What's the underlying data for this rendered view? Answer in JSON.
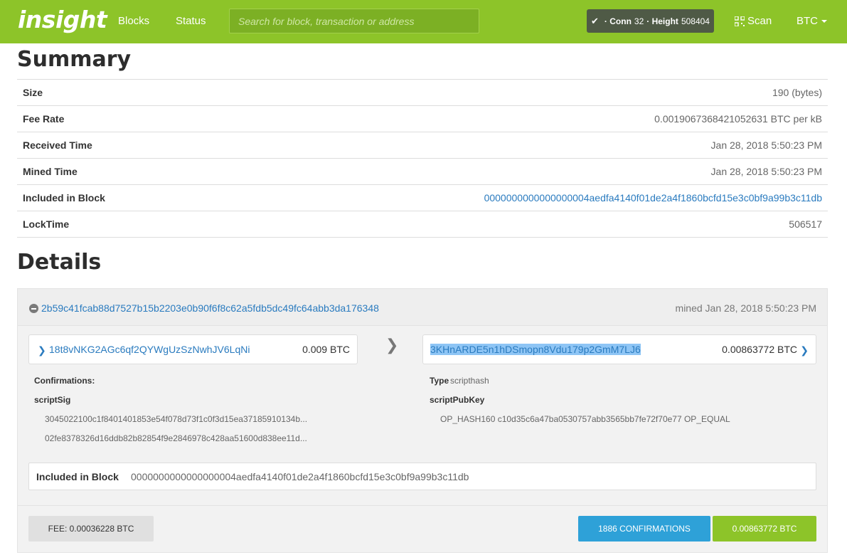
{
  "nav": {
    "brand": "insight",
    "links": [
      "Blocks",
      "Status"
    ],
    "search_placeholder": "Search for block, transaction or address",
    "conn_label": "· Conn",
    "conn_value": "32",
    "height_label": "· Height",
    "height_value": "508404",
    "scan_label": "Scan",
    "currency": "BTC"
  },
  "summary": {
    "heading": "Summary",
    "rows": [
      {
        "label": "Size",
        "value": "190 (bytes)"
      },
      {
        "label": "Fee Rate",
        "value": "0.0019067368421052631 BTC per kB"
      },
      {
        "label": "Received Time",
        "value": "Jan 28, 2018 5:50:23 PM"
      },
      {
        "label": "Mined Time",
        "value": "Jan 28, 2018 5:50:23 PM"
      },
      {
        "label": "Included in Block",
        "value": "0000000000000000004aedfa4140f01de2a4f1860bcfd15e3c0bf9a99b3c11db"
      },
      {
        "label": "LockTime",
        "value": "506517"
      }
    ]
  },
  "details": {
    "heading": "Details",
    "txid": "2b59c41fcab88d7527b15b2203e0b90f6f8c62a5fdb5dc49fc64abb3da176348",
    "mined": "mined Jan 28, 2018 5:50:23 PM",
    "input": {
      "address": "18t8vNKG2AGc6qf2QYWgUzSzNwhJV6LqNi",
      "amount": "0.009 BTC",
      "confirmations_label": "Confirmations:",
      "scriptsig_label": "scriptSig",
      "scriptsig_lines": [
        "3045022100c1f8401401853e54f078d73f1c0f3d15ea37185910134b...",
        "02fe8378326d16ddb82b82854f9e2846978c428aa51600d838ee11d..."
      ]
    },
    "output": {
      "address": "3KHnARDE5n1hDSmopn8Vdu179p2GmM7LJ6",
      "amount": "0.00863772 BTC",
      "type_label": "Type",
      "type_value": "scripthash",
      "scriptpubkey_label": "scriptPubKey",
      "scriptpubkey_value": "OP_HASH160 c10d35c6a47ba0530757abb3565bb7fe72f70e77 OP_EQUAL"
    },
    "included_label": "Included in Block",
    "included_hash": "0000000000000000004aedfa4140f01de2a4f1860bcfd15e3c0bf9a99b3c11db",
    "fee": "FEE: 0.00036228 BTC",
    "confirmations": "1886 CONFIRMATIONS",
    "total": "0.00863772 BTC"
  },
  "colors": {
    "brand_green": "#8dc429",
    "link_blue": "#2a7bbf",
    "confirm_blue": "#2ea1d8"
  }
}
